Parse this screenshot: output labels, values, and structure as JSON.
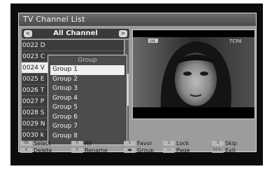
{
  "window": {
    "title": "TV Channel List"
  },
  "category": {
    "label": "All Channel",
    "left_arrow": "<",
    "right_arrow": ">"
  },
  "channels": [
    {
      "text": "0022 D"
    },
    {
      "text": "0023 C"
    },
    {
      "text": "0024 V"
    },
    {
      "text": "0025 E"
    },
    {
      "text": "0026 T"
    },
    {
      "text": "0027 P"
    },
    {
      "text": "0028 S"
    },
    {
      "text": "0029 N"
    },
    {
      "text": "0030 k"
    }
  ],
  "selected_channel_index": 2,
  "group_popup": {
    "header": "Group",
    "items": [
      "Group 1",
      "Group 2",
      "Group 3",
      "Group 4",
      "Group 5",
      "Group 6",
      "Group 7",
      "Group 8"
    ],
    "selected_index": 0
  },
  "preview": {
    "channel_logo": "TCPA",
    "corner_text": "SME"
  },
  "help_bar": {
    "select": {
      "key": "OK",
      "label": "Select"
    },
    "all": {
      "key": "0",
      "label": "All"
    },
    "favor": {
      "key": "1",
      "label": "Favor"
    },
    "lock": {
      "key": "2",
      "label": "Lock"
    },
    "skip": {
      "key": "3",
      "label": "Skip"
    },
    "delete": {
      "key": "4",
      "label": "Delete"
    },
    "rename": {
      "key": "5",
      "label": "Rename"
    },
    "group": {
      "key": "◀▶",
      "label": "Group"
    },
    "page": {
      "key": "«»",
      "label": "Page"
    },
    "exit": {
      "key": "MENU",
      "label": "Exit"
    }
  },
  "colors": {
    "panel_bg": "#9c9c9c",
    "row_bg": "#3c3c3c",
    "highlight": "#efefef",
    "title_bar": "#5a5a5a"
  }
}
